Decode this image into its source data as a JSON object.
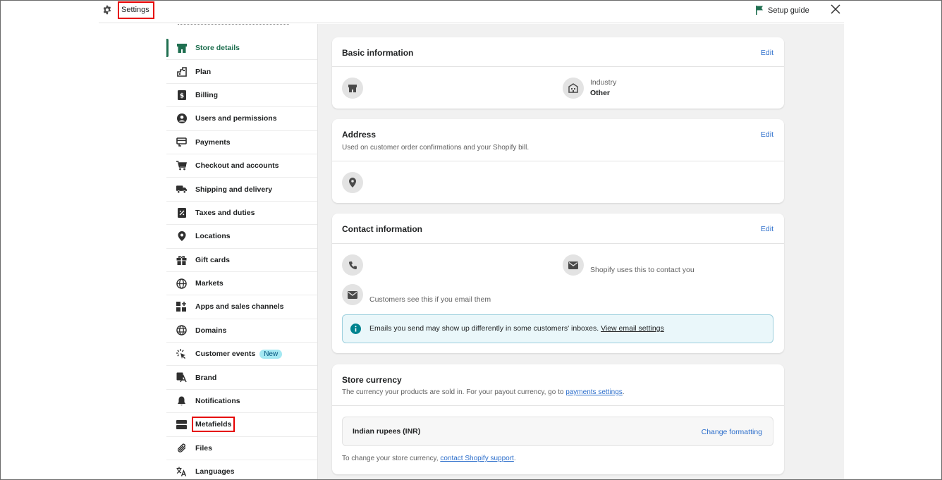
{
  "header": {
    "title": "Settings",
    "setup_guide": "Setup guide"
  },
  "sidebar": {
    "items": [
      {
        "label": "Store details",
        "icon": "store-icon",
        "active": true
      },
      {
        "label": "Plan",
        "icon": "plan-icon"
      },
      {
        "label": "Billing",
        "icon": "billing-icon"
      },
      {
        "label": "Users and permissions",
        "icon": "user-icon"
      },
      {
        "label": "Payments",
        "icon": "payments-icon"
      },
      {
        "label": "Checkout and accounts",
        "icon": "cart-icon"
      },
      {
        "label": "Shipping and delivery",
        "icon": "truck-icon"
      },
      {
        "label": "Taxes and duties",
        "icon": "tax-icon"
      },
      {
        "label": "Locations",
        "icon": "location-pin-icon"
      },
      {
        "label": "Gift cards",
        "icon": "gift-icon"
      },
      {
        "label": "Markets",
        "icon": "globe-icon"
      },
      {
        "label": "Apps and sales channels",
        "icon": "apps-icon"
      },
      {
        "label": "Domains",
        "icon": "domain-globe-icon"
      },
      {
        "label": "Customer events",
        "icon": "cursor-click-icon",
        "badge": "New"
      },
      {
        "label": "Brand",
        "icon": "brand-icon"
      },
      {
        "label": "Notifications",
        "icon": "bell-icon"
      },
      {
        "label": "Metafields",
        "icon": "metafields-icon"
      },
      {
        "label": "Files",
        "icon": "paperclip-icon"
      },
      {
        "label": "Languages",
        "icon": "translate-icon"
      }
    ]
  },
  "basic_info": {
    "title": "Basic information",
    "edit": "Edit",
    "industry_label": "Industry",
    "industry_value": "Other"
  },
  "address": {
    "title": "Address",
    "subtitle": "Used on customer order confirmations and your Shopify bill.",
    "edit": "Edit"
  },
  "contact": {
    "title": "Contact information",
    "edit": "Edit",
    "store_email_note": "Shopify uses this to contact you",
    "sender_email_note": "Customers see this if you email them",
    "info_text": "Emails you send may show up differently in some customers' inboxes.",
    "info_link": "View email settings"
  },
  "currency": {
    "title": "Store currency",
    "subtitle_prefix": "The currency your products are sold in. For your payout currency, go to ",
    "subtitle_link": "payments settings",
    "subtitle_suffix": ".",
    "value": "Indian rupees (INR)",
    "change_formatting": "Change formatting",
    "footer_prefix": "To change your store currency, ",
    "footer_link": "contact Shopify support",
    "footer_suffix": "."
  },
  "colors": {
    "accent_green": "#1f6f50",
    "link_blue": "#2c6ecb",
    "highlight_red": "#e60000",
    "info_bg": "#eaf7fa"
  }
}
